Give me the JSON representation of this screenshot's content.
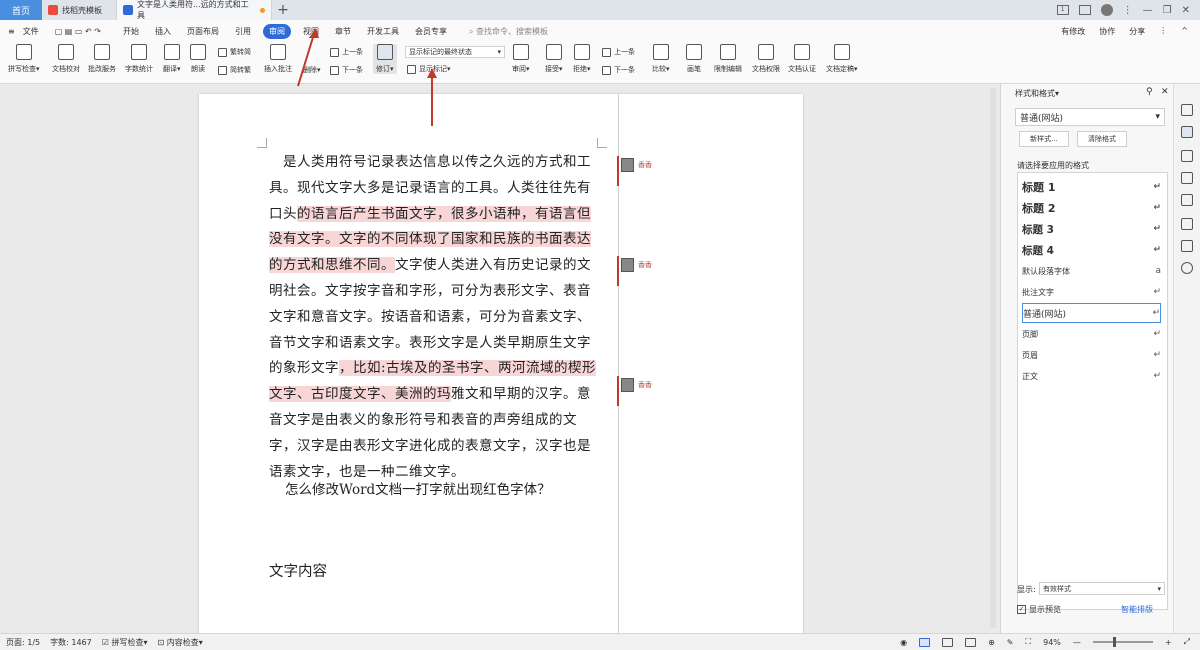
{
  "titlebar": {
    "home_tab": "首页",
    "tabs": [
      {
        "label": "找稻壳模板",
        "badge_color": "#e74c3c"
      },
      {
        "label": "文字是人类用符...远的方式和工具",
        "badge_color": "#2f6bd8"
      }
    ],
    "add_tab": "+"
  },
  "menubar": {
    "file": "文件",
    "items": [
      "开始",
      "插入",
      "页面布局",
      "引用",
      "审阅",
      "视图",
      "章节",
      "开发工具",
      "会员专享"
    ],
    "active": "审阅",
    "search": "查找命令、搜索模板",
    "right": [
      "有修改",
      "协作",
      "分享"
    ]
  },
  "ribbon": {
    "buttons": [
      {
        "label": "拼写检查▾",
        "icon": "abc-spellcheck-icon"
      },
      {
        "label": "文档校对",
        "icon": "proofread-icon"
      },
      {
        "label": "批改服务",
        "icon": "correction-icon"
      },
      {
        "label": "字数统计",
        "icon": "wordcount-icon"
      },
      {
        "label": "翻译▾",
        "icon": "translate-icon"
      },
      {
        "label": "朗读",
        "icon": "read-aloud-icon"
      },
      {
        "label": "插入批注",
        "icon": "insert-comment-icon"
      },
      {
        "label": "修订▾",
        "icon": "track-changes-icon"
      },
      {
        "label": "审阅▾",
        "icon": "review-icon"
      },
      {
        "label": "接受▾",
        "icon": "accept-icon"
      },
      {
        "label": "拒绝▾",
        "icon": "reject-icon"
      },
      {
        "label": "比较▾",
        "icon": "compare-icon"
      },
      {
        "label": "画笔",
        "icon": "pen-icon"
      },
      {
        "label": "限制编辑",
        "icon": "restrict-edit-icon"
      },
      {
        "label": "文档权限",
        "icon": "doc-permission-icon"
      },
      {
        "label": "文档认证",
        "icon": "doc-cert-icon"
      },
      {
        "label": "文档定稿▾",
        "icon": "finalize-icon"
      }
    ],
    "small": {
      "trad_simp": "繁转简",
      "simp_trad": "简转繁",
      "prev1": "上一条",
      "next1": "下一条",
      "delete": "删除▾",
      "markup_state": "显示标记的最终状态",
      "show_markup": "显示标记▾",
      "prev2": "上一条",
      "next2": "下一条"
    }
  },
  "document": {
    "para1_parts": [
      {
        "text": "是人类用符号记录表达信息以传之久远的方式和工具。现代文字大多是记录语言的工具。人类往往先有口头",
        "hl": false
      },
      {
        "text": "的语言后产生书面文字，很多小语种，有语言但没有文字。文字的不同体现了国家和民族的书面表达的方式和思维不同。",
        "hl": true
      },
      {
        "text": "文字使人类进入有历史记录的文明社会。文字按字音和字形，可分为表形文字、表音文字和意音文字。按语音和语素，可分为音素文字、音节文字和语素文字。表形文字是人类早期原生文字的象形文字",
        "hl": false
      },
      {
        "text": "，比如:古埃及的圣书字、两河流域的楔形文字、古印度文字、美洲的玛",
        "hl": true
      },
      {
        "text": "雅文和早期的汉字。意音文字是由表义的象形符号和表音的声旁组成的文字，汉字是由表形文字进化成的表意文字，汉字也是语素文字，也是一种二维文字。",
        "hl": false
      }
    ],
    "question": "怎么修改Word文档一打字就出现红色字体？",
    "heading": "文字内容",
    "comments": [
      "香香",
      "香香",
      "香香"
    ],
    "highlight_color": "#f8d6d6"
  },
  "styles_panel": {
    "title": "样式和格式▾",
    "current": "普通(网站)",
    "new_style": "新样式...",
    "clear_format": "清除格式",
    "apply_label": "请选择要应用的格式",
    "styles": [
      {
        "label": "标题 1",
        "mark": "↵"
      },
      {
        "label": "标题 2",
        "mark": "↵"
      },
      {
        "label": "标题 3",
        "mark": "↵"
      },
      {
        "label": "标题 4",
        "mark": "↵"
      },
      {
        "label": "默认段落字体",
        "mark": "a"
      },
      {
        "label": "批注文字",
        "mark": "↵"
      },
      {
        "label": "普通(网站)",
        "mark": "↵"
      },
      {
        "label": "页脚",
        "mark": "↵"
      },
      {
        "label": "页眉",
        "mark": "↵"
      },
      {
        "label": "正文",
        "mark": "↵"
      }
    ],
    "show_label": "显示:",
    "show_value": "有效样式",
    "preview": "显示预览",
    "smart": "智能排版"
  },
  "statusbar": {
    "page": "页面: 1/5",
    "words": "字数: 1467",
    "spell": "拼写检查▾",
    "content_check": "内容检查▾",
    "zoom": "94%"
  },
  "accent_color": "#2f6bd8",
  "arrow_color": "#c0392b"
}
